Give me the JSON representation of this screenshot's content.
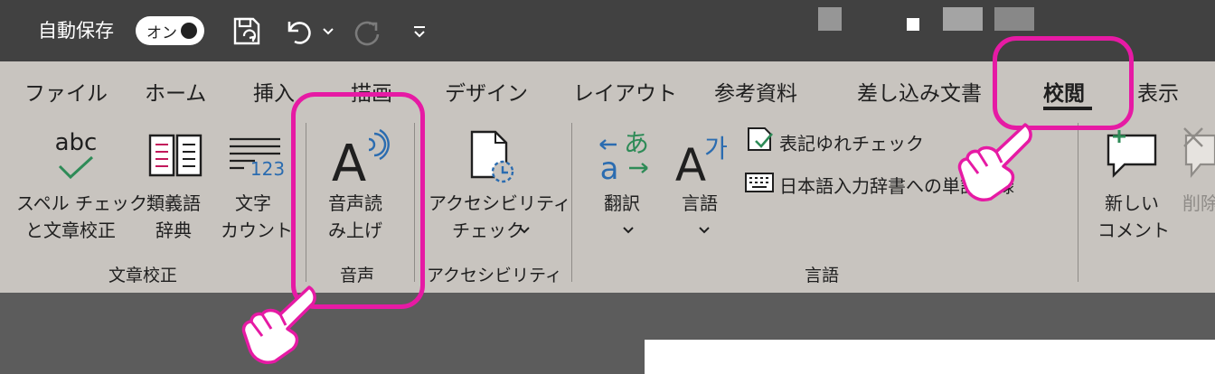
{
  "titlebar": {
    "autosave_label": "自動保存",
    "toggle_label": "オン"
  },
  "tabs": [
    {
      "label": "ファイル"
    },
    {
      "label": "ホーム"
    },
    {
      "label": "挿入"
    },
    {
      "label": "描画"
    },
    {
      "label": "デザイン"
    },
    {
      "label": "レイアウト"
    },
    {
      "label": "参考資料"
    },
    {
      "label": "差し込み文書"
    },
    {
      "label": "校閲",
      "active": true
    },
    {
      "label": "表示"
    }
  ],
  "groups": {
    "proofing": {
      "label": "文章校正",
      "spelling": {
        "line1": "スペル チェック",
        "line2": "と文章校正",
        "icon_text": "abc"
      },
      "thesaurus": {
        "line1": "類義語",
        "line2": "辞典"
      },
      "wordcount": {
        "line1": "文字",
        "line2": "カウント",
        "icon_text": "123"
      }
    },
    "speech": {
      "label": "音声",
      "readaloud": {
        "line1": "音声読",
        "line2": "み上げ",
        "icon_text": "A"
      }
    },
    "accessibility": {
      "label": "アクセシビリティ",
      "check": {
        "line1": "アクセシビリティ",
        "line2": "チェック"
      }
    },
    "language": {
      "label": "言語",
      "translate": {
        "label": "翻訳",
        "icon_a": "a",
        "icon_kana": "あ"
      },
      "language": {
        "label": "言語",
        "icon_a": "A",
        "icon_ga": "가"
      },
      "consistency": {
        "label": "表記ゆれチェック"
      },
      "ime_dictionary": {
        "label": "日本語入力辞書への単語登録"
      }
    },
    "comments": {
      "new": {
        "line1": "新しい",
        "line2": "コメント"
      },
      "delete": {
        "line1": "削除"
      }
    }
  },
  "colors": {
    "highlight": "#e61aa4",
    "ribbon_bg": "#c8c4bf",
    "titlebar_bg": "#414141",
    "green_check": "#2e8b57",
    "blue_accent": "#2b6cb0"
  }
}
